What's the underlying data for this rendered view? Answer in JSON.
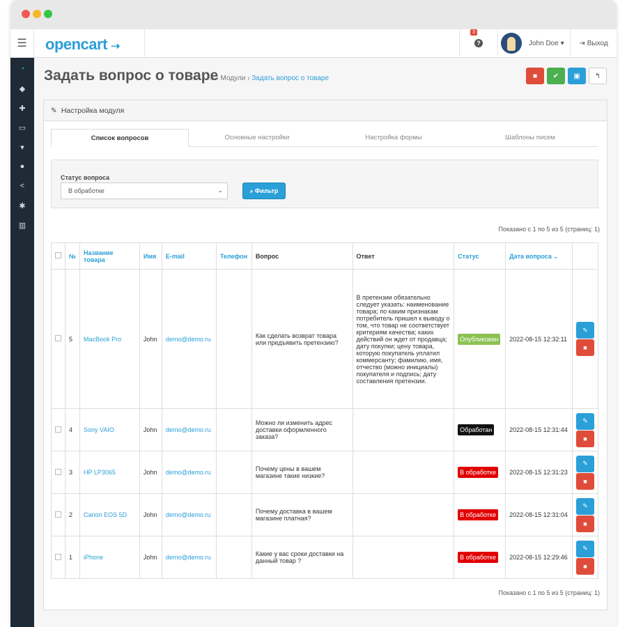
{
  "header": {
    "logo": "opencart",
    "logo_cart": "🛒",
    "notification_count": "3",
    "help_icon": "question-icon",
    "user_name": "John Doe",
    "user_caret": "▾",
    "logout_label": "Выход"
  },
  "sidebar": {
    "items": [
      "dashboard-icon",
      "tag-icon",
      "puzzle-icon",
      "desktop-icon",
      "cart-icon",
      "user-icon",
      "share-icon",
      "gear-icon",
      "bar-chart-icon"
    ]
  },
  "page": {
    "title": "Задать вопрос о товаре",
    "breadcrumb_home_icon": "home-icon",
    "breadcrumb": [
      "Модули",
      "Задать вопрос о товаре"
    ]
  },
  "panel": {
    "heading": "Настройка модуля",
    "tabs": [
      {
        "label": "Список вопросов",
        "active": true
      },
      {
        "label": "Основные настройки",
        "active": false
      },
      {
        "label": "Настройка формы",
        "active": false
      },
      {
        "label": "Шаблоны писем",
        "active": false
      }
    ]
  },
  "filter": {
    "label": "Статус вопроса",
    "selected": "В обработке",
    "button": "Фильтр"
  },
  "pagination": {
    "text": "Показано с 1 по 5 из 5 (страниц: 1)"
  },
  "table": {
    "headers": {
      "no": "№",
      "product": "Название товара",
      "name": "Имя",
      "email": "E-mail",
      "phone": "Телефон",
      "question": "Вопрос",
      "answer": "Ответ",
      "status": "Статус",
      "date": "Дата вопроса"
    },
    "sort_caret": "⌄",
    "rows": [
      {
        "no": "5",
        "product": "MacBook Pro",
        "name": "John",
        "email": "demo@demo.ru",
        "phone": "",
        "question": "Как сделать возврат товара или предъявить претензию?",
        "answer": "В претензии обязательно следует указать: наименование товара; по каким признакам потребитель пришел к выводу о том, что товар не соответствует критериям качества; каких действий он ждет от продавца; дату покупки; цену товара, которую покупатель уплатил коммерсанту; фамилию, имя, отчество (можно инициалы) покупателя и подпись; дату составления претензии.",
        "status": "Опубликован",
        "status_kind": "pub",
        "date": "2022-08-15 12:32:11"
      },
      {
        "no": "4",
        "product": "Sony VAIO",
        "name": "John",
        "email": "demo@demo.ru",
        "phone": "",
        "question": "Можно ли изменить адрес доставки оформленного заказа?",
        "answer": "",
        "status": "Обработан",
        "status_kind": "done",
        "date": "2022-08-15 12:31:44"
      },
      {
        "no": "3",
        "product": "HP LP3065",
        "name": "John",
        "email": "demo@demo.ru",
        "phone": "",
        "question": "Почему цены в вашем магазине такие низкие?",
        "answer": "",
        "status": "В обработке",
        "status_kind": "proc",
        "date": "2022-08-15 12:31:23"
      },
      {
        "no": "2",
        "product": "Canon EOS 5D",
        "name": "John",
        "email": "demo@demo.ru",
        "phone": "",
        "question": "Почему доставка в вашем магазине платная?",
        "answer": "",
        "status": "В обработке",
        "status_kind": "proc",
        "date": "2022-08-15 12:31:04"
      },
      {
        "no": "1",
        "product": "iPhone",
        "name": "John",
        "email": "demo@demo.ru",
        "phone": "",
        "question": "Какие у вас сроки доставки на данный товар ?",
        "answer": "",
        "status": "В обработке",
        "status_kind": "proc",
        "date": "2022-08-15 12:29:46"
      }
    ]
  },
  "colors": {
    "accent": "#2b9fd8",
    "danger": "#e04c3a",
    "success": "#4caf50",
    "published": "#8cc152",
    "processed": "#111111",
    "processing": "#e10000"
  }
}
